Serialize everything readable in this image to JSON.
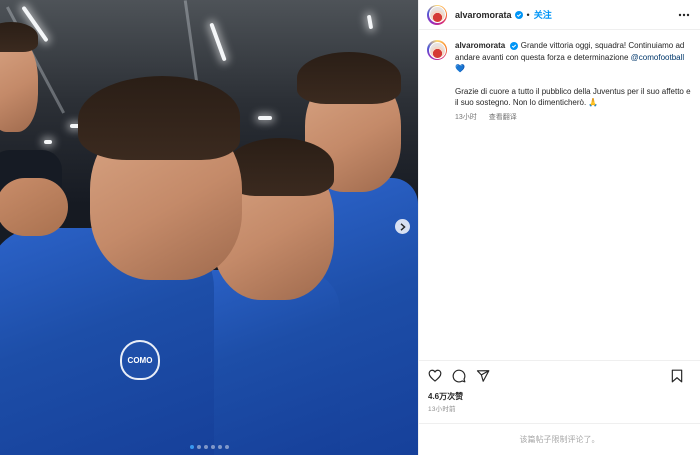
{
  "post": {
    "media": {
      "image_alt": "Como players in a huddle",
      "badge_text": "COMO",
      "carousel": {
        "total": 6,
        "active_index": 0
      }
    },
    "author": {
      "username": "alvaromorata",
      "verified": true,
      "follow_label": "关注",
      "separator": "•"
    },
    "caption": {
      "username": "alvaromorata",
      "text_part1": "Grande vittoria oggi, squadra! Continuiamo ad andare avanti con questa forza e determinazione ",
      "mention": "@comofootball",
      "heart_emoji": "💙",
      "text_part2": "Grazie di cuore a tutto il pubblico della Juventus per il suo affetto e il suo sostegno. Non lo dimenticherò. 🙏",
      "age": "13小时",
      "translate_label": "查看翻译"
    },
    "stats": {
      "likes": "4.6万次赞",
      "posted_ago": "13小时前"
    },
    "comments_disabled_text": "该篇帖子限制评论了。"
  },
  "icons": {
    "like": "heart-icon",
    "comment": "comment-icon",
    "share": "share-icon",
    "save": "bookmark-icon",
    "more": "more-icon",
    "verified": "verified-badge-icon",
    "next": "chevron-right-icon"
  },
  "colors": {
    "accent": "#0095f6",
    "verified": "#0095f6",
    "mention": "#00376b",
    "jersey": "#1d4ea8"
  }
}
